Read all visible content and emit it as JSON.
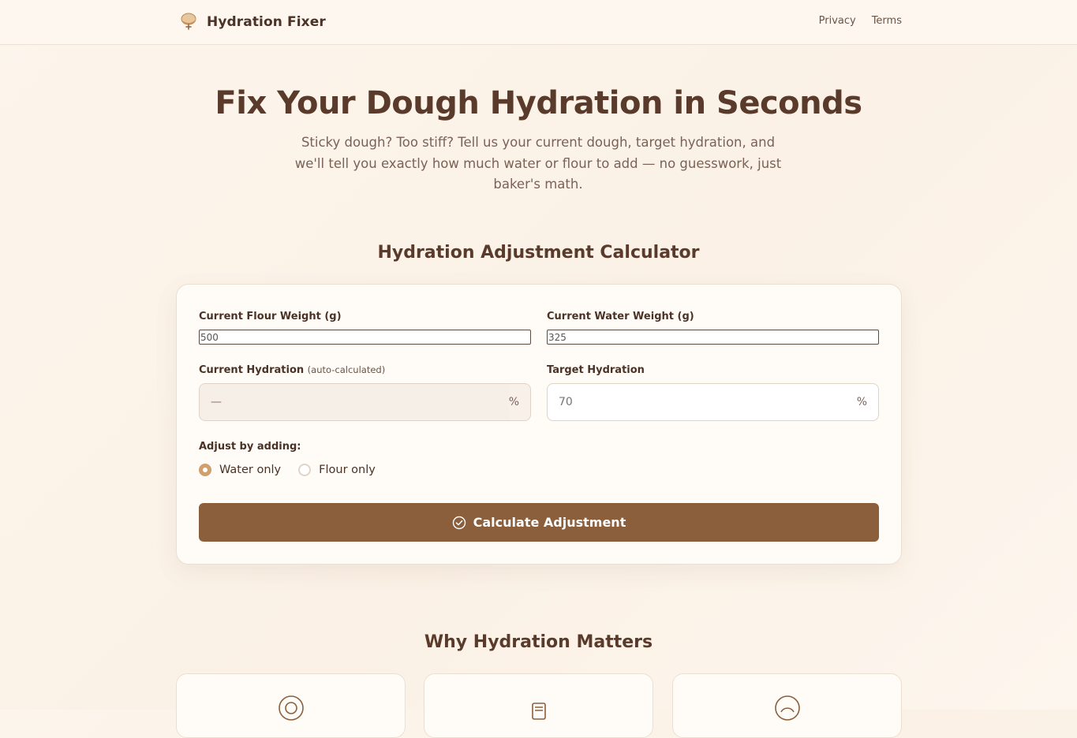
{
  "header": {
    "brand_name": "Hydration Fixer",
    "brand_icon": "bread-bowl-icon",
    "nav": {
      "privacy": "Privacy",
      "terms": "Terms"
    }
  },
  "hero": {
    "title": "Fix Your Dough Hydration in Seconds",
    "subtitle": "Sticky dough? Too stiff? Tell us your current dough, target hydration, and we'll tell you exactly how much water or flour to add — no guesswork, just baker's math."
  },
  "calculator": {
    "title": "Hydration Adjustment Calculator",
    "flour": {
      "label": "Current Flour Weight (g)",
      "value": "500"
    },
    "water": {
      "label": "Current Water Weight (g)",
      "value": "325"
    },
    "current_hydration": {
      "label": "Current Hydration",
      "note": "(auto-calculated)",
      "value": "—",
      "unit": "%"
    },
    "target_hydration": {
      "label": "Target Hydration",
      "placeholder": "70",
      "unit": "%"
    },
    "adjust_label": "Adjust by adding:",
    "options": [
      {
        "label": "Water only",
        "checked": true
      },
      {
        "label": "Flour only",
        "checked": false
      }
    ],
    "button_label": "Calculate Adjustment"
  },
  "why": {
    "title": "Why Hydration Matters",
    "cards": [
      {
        "icon": "target-icon"
      },
      {
        "icon": "document-icon"
      },
      {
        "icon": "gauge-icon"
      }
    ]
  },
  "colors": {
    "accent": "#8b5e3c",
    "radio_accent": "#d19e6c",
    "heading": "#5a3a2b",
    "background": "#fcf5ec"
  }
}
